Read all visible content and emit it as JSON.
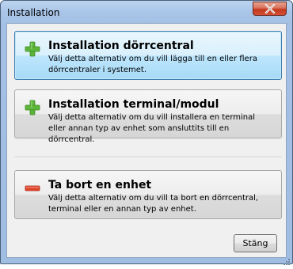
{
  "window": {
    "title": "Installation"
  },
  "options": [
    {
      "heading": "Installation dörrcentral",
      "description": "Välj detta alternativ om du vill lägga till en eller flera dörrcentraler i systemet.",
      "icon": "plus-icon",
      "icon_color": "#5cb53a"
    },
    {
      "heading": "Installation terminal/modul",
      "description": "Välj detta alternativ om du vill installera en terminal eller annan typ av enhet som ansluttits till en dörrcentral.",
      "icon": "plus-icon",
      "icon_color": "#5cb53a"
    },
    {
      "heading": "Ta bort en enhet",
      "description": "Välj detta alternativ om du vill ta bort en dörrcentral, terminal eller en annan typ av enhet.",
      "icon": "minus-icon",
      "icon_color": "#e0452c"
    }
  ],
  "footer": {
    "close_label": "Stäng"
  }
}
